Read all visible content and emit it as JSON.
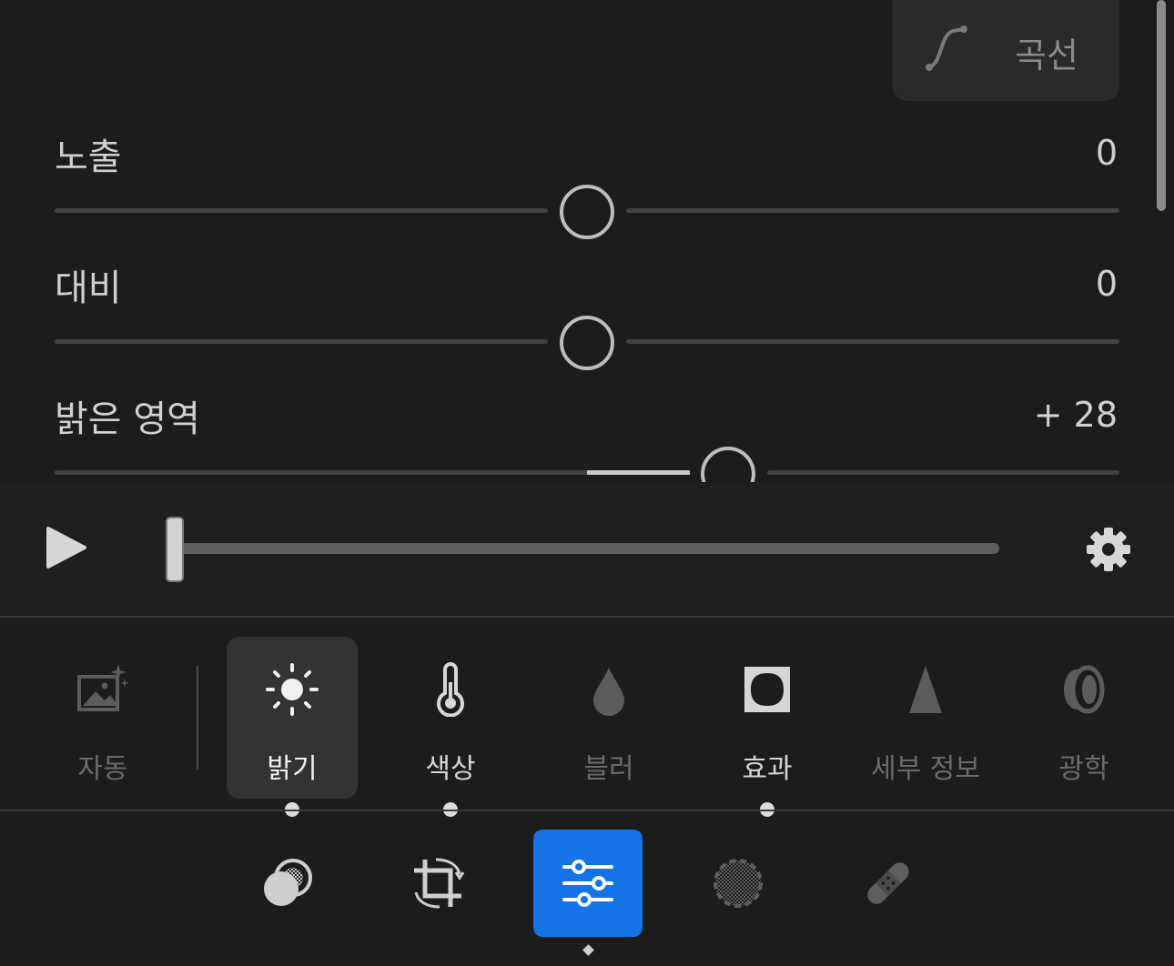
{
  "curve_button": {
    "label": "곡선",
    "icon": "curve-icon"
  },
  "sliders": [
    {
      "label": "노출",
      "value": "0",
      "position": 0.5
    },
    {
      "label": "대비",
      "value": "0",
      "position": 0.5
    },
    {
      "label": "밝은 영역",
      "value": "+ 28",
      "position": 0.64
    }
  ],
  "playback": {
    "play_icon": "play-icon",
    "settings_icon": "gear-icon",
    "progress": 0.0
  },
  "tabs": [
    {
      "label": "자동",
      "icon": "auto-photo-icon",
      "state": "dim"
    },
    {
      "label": "밝기",
      "icon": "sun-icon",
      "state": "active"
    },
    {
      "label": "색상",
      "icon": "thermometer-icon",
      "state": "bright"
    },
    {
      "label": "블러",
      "icon": "drop-icon",
      "state": "dim"
    },
    {
      "label": "효과",
      "icon": "vignette-icon",
      "state": "bright"
    },
    {
      "label": "세부 정보",
      "icon": "triangle-icon",
      "state": "dim"
    },
    {
      "label": "광학",
      "icon": "lens-icon",
      "state": "dim"
    }
  ],
  "toolbar": [
    {
      "icon": "presets-icon"
    },
    {
      "icon": "crop-rotate-icon"
    },
    {
      "icon": "sliders-icon",
      "active": true
    },
    {
      "icon": "masking-icon"
    },
    {
      "icon": "healing-icon"
    }
  ],
  "colors": {
    "accent": "#1473e6",
    "background": "#1c1c1c"
  }
}
